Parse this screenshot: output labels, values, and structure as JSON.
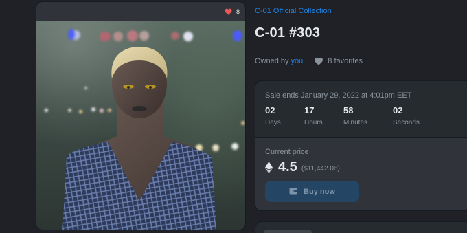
{
  "media": {
    "favorites_count": "8",
    "image_alt": "C-01 #303 digital character artwork"
  },
  "item": {
    "collection_name": "C-01 Official Collection",
    "title": "C-01 #303",
    "owned_by_label": "Owned by",
    "owner": "you",
    "favorites_label": "8 favorites"
  },
  "sale": {
    "ends_text": "Sale ends January 29, 2022 at 4:01pm EET",
    "countdown": [
      {
        "value": "02",
        "label": "Days"
      },
      {
        "value": "17",
        "label": "Hours"
      },
      {
        "value": "58",
        "label": "Minutes"
      },
      {
        "value": "02",
        "label": "Seconds"
      }
    ],
    "current_price_label": "Current price",
    "price_eth": "4.5",
    "price_usd": "($11,442.06)",
    "buy_label": "Buy now"
  },
  "colors": {
    "background": "#1f2126",
    "link": "#2081e2",
    "button": "#254565",
    "heart": "#eb5757"
  },
  "icons": [
    "heart-icon",
    "ethereum-icon",
    "wallet-icon"
  ]
}
